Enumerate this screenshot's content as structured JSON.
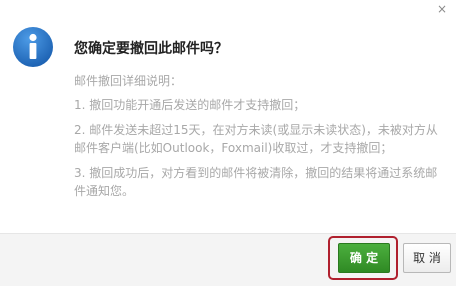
{
  "dialog": {
    "title": "您确定要撤回此邮件吗？",
    "icon": "info-icon",
    "close_glyph": "×"
  },
  "details": {
    "heading": "邮件撤回详细说明：",
    "items": [
      "1. 撤回功能开通后发送的邮件才支持撤回；",
      "2. 邮件发送未超过15天，在对方未读(或显示未读状态)，未被对方从邮件客户端(比如Outlook，Foxmail)收取过，才支持撤回；",
      "3. 撤回成功后，对方看到的邮件将被清除，撤回的结果将通过系统邮件通知您。"
    ]
  },
  "buttons": {
    "confirm_label": "确 定",
    "cancel_label": "取 消"
  },
  "colors": {
    "accent_green": "#3a9b2e",
    "icon_blue": "#1f6fc4",
    "highlight_red": "#b0202e"
  }
}
